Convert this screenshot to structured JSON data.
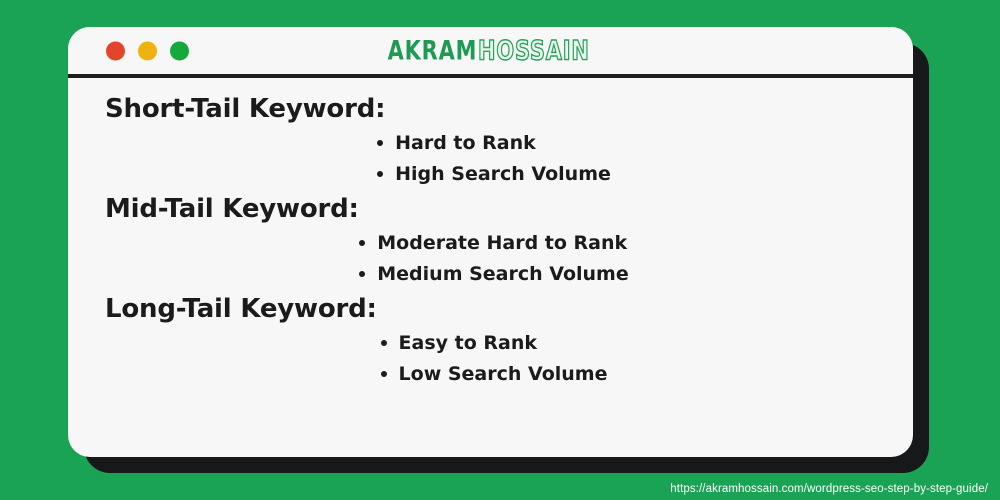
{
  "window": {
    "traffic_lights": [
      {
        "name": "close",
        "color": "#e2452c"
      },
      {
        "name": "minimize",
        "color": "#eeb211"
      },
      {
        "name": "maximize",
        "color": "#15a83c"
      }
    ],
    "brand": {
      "first": "AKRAM",
      "second": "HOSSAIN",
      "first_color": "#1f9a52",
      "second_outline_color": "#2aa35c"
    }
  },
  "content": {
    "groups": [
      {
        "heading": "Short-Tail Keyword:",
        "items": [
          "Hard to Rank",
          "High Search Volume"
        ]
      },
      {
        "heading": "Mid-Tail Keyword:",
        "items": [
          "Moderate Hard to Rank",
          "Medium Search Volume"
        ]
      },
      {
        "heading": "Long-Tail Keyword:",
        "items": [
          "Easy to Rank",
          "Low Search Volume"
        ]
      }
    ]
  },
  "footer": {
    "source_url": "https://akramhossain.com/wordpress-seo-step-by-step-guide/"
  },
  "theme": {
    "background": "#1ba355",
    "card_background": "#f7f7f7",
    "shadow": "#17181a",
    "text": "#1b1b1b"
  }
}
